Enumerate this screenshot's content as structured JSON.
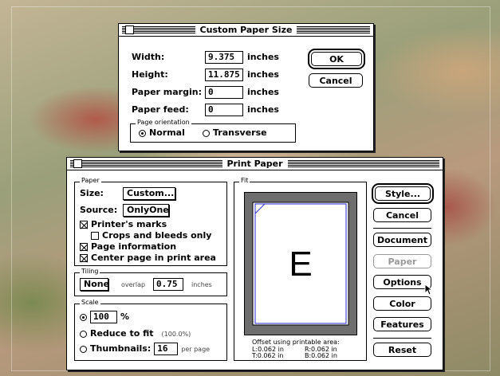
{
  "custom_dialog": {
    "title": "Custom Paper Size",
    "width_label": "Width:",
    "width_value": "9.375",
    "height_label": "Height:",
    "height_value": "11.875",
    "margin_label": "Paper margin:",
    "margin_value": "0",
    "feed_label": "Paper feed:",
    "feed_value": "0",
    "units": "inches",
    "ok_label": "OK",
    "cancel_label": "Cancel",
    "orientation_group": "Page orientation",
    "orientation_normal": "Normal",
    "orientation_transverse": "Transverse"
  },
  "print_dialog": {
    "title": "Print Paper",
    "paper_group": "Paper",
    "size_label": "Size:",
    "size_value": "Custom...",
    "source_label": "Source:",
    "source_value": "OnlyOne",
    "printers_marks": "Printer's marks",
    "crops_bleeds": "Crops and bleeds only",
    "page_info": "Page information",
    "center_page": "Center page in print area",
    "tiling_group": "Tiling",
    "tiling_value": "None",
    "overlap_label": "overlap",
    "overlap_value": "0.75",
    "overlap_units": "inches",
    "scale_group": "Scale",
    "scale_value": "100",
    "scale_unit": "%",
    "reduce_label": "Reduce to fit",
    "reduce_percent": "(100.0%)",
    "thumbnails_label": "Thumbnails:",
    "thumbnails_value": "16",
    "per_page": "per page",
    "fit_group": "Fit",
    "preview_letter": "E",
    "offset_title": "Offset using printable area:",
    "offset_L": "L:0.062 in",
    "offset_R": "R:0.062 in",
    "offset_T": "T:0.062 in",
    "offset_B": "B:0.062 in",
    "buttons": {
      "style": "Style...",
      "cancel": "Cancel",
      "document": "Document",
      "paper": "Paper",
      "options": "Options",
      "color": "Color",
      "features": "Features",
      "reset": "Reset"
    }
  }
}
